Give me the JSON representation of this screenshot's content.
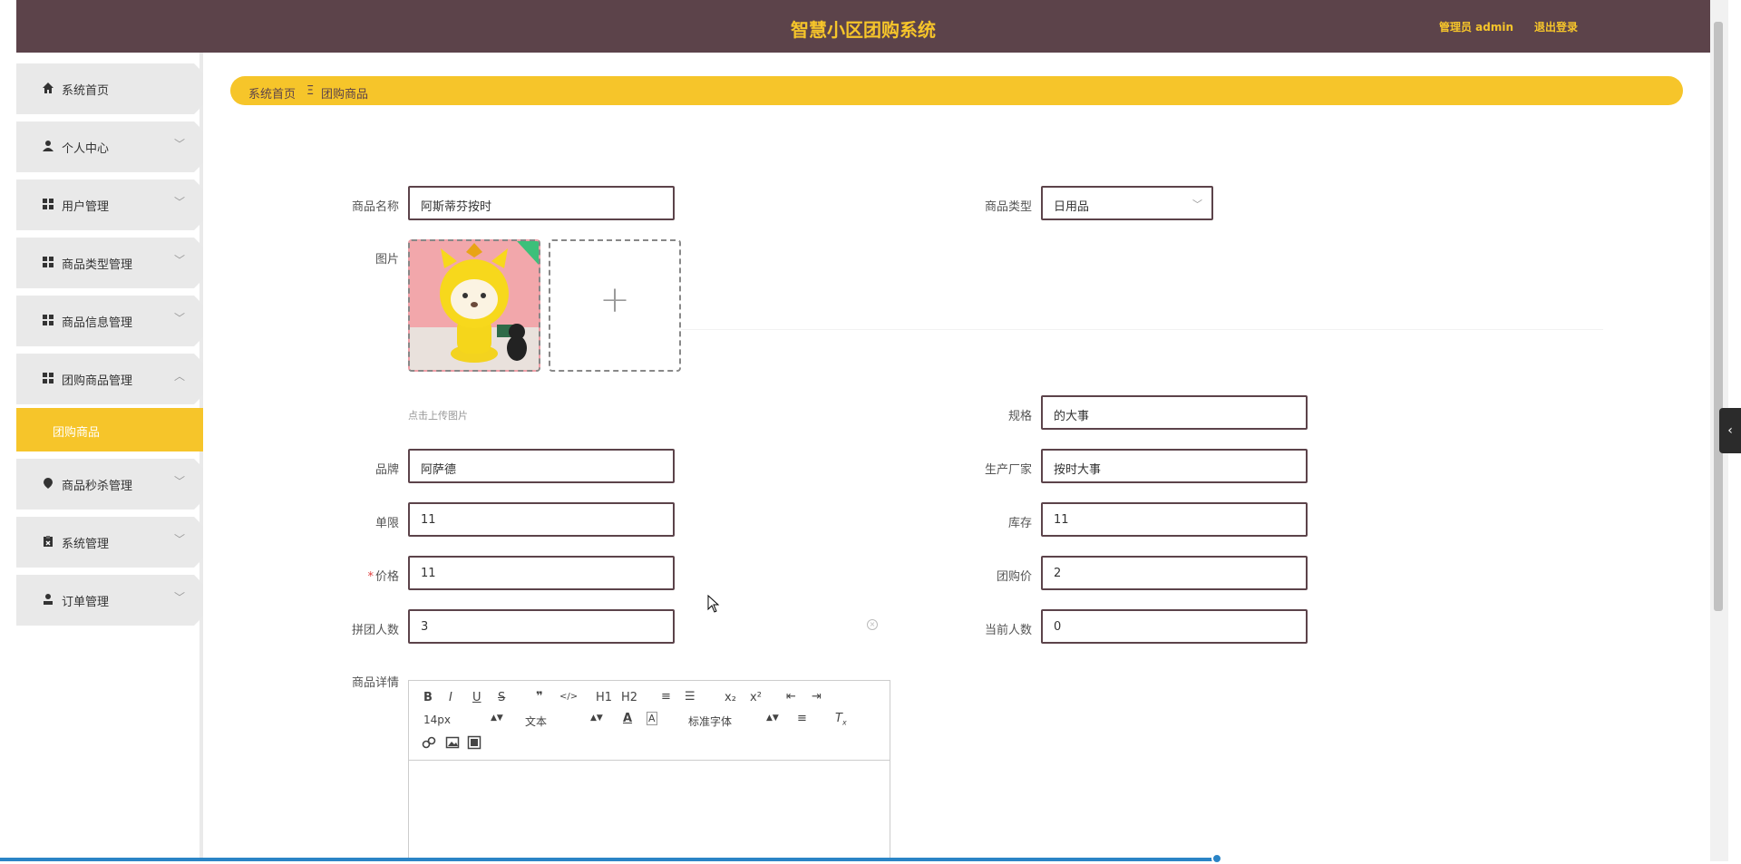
{
  "header": {
    "title": "智慧小区团购系统",
    "admin": "管理员 admin",
    "logout": "退出登录"
  },
  "sidebar": {
    "items": [
      {
        "label": "系统首页",
        "icon": "home-icon"
      },
      {
        "label": "个人中心",
        "icon": "user-icon"
      },
      {
        "label": "用户管理",
        "icon": "grid-icon"
      },
      {
        "label": "商品类型管理",
        "icon": "grid-icon"
      },
      {
        "label": "商品信息管理",
        "icon": "grid-icon"
      },
      {
        "label": "团购商品管理",
        "icon": "grid-icon"
      },
      {
        "label": "商品秒杀管理",
        "icon": "location-icon"
      },
      {
        "label": "系统管理",
        "icon": "clipboard-icon"
      },
      {
        "label": "订单管理",
        "icon": "person-icon"
      }
    ],
    "active_sub": "团购商品"
  },
  "breadcrumb": {
    "home": "系统首页",
    "sep": "Ξ",
    "current": "团购商品"
  },
  "form": {
    "name": {
      "label": "商品名称",
      "value": "阿斯蒂芬按时"
    },
    "type": {
      "label": "商品类型",
      "value": "日用品"
    },
    "image": {
      "label": "图片",
      "hint": "点击上传图片"
    },
    "spec": {
      "label": "规格",
      "value": "的大事"
    },
    "brand": {
      "label": "品牌",
      "value": "阿萨德"
    },
    "maker": {
      "label": "生产厂家",
      "value": "按时大事"
    },
    "limit": {
      "label": "单限",
      "value": "11"
    },
    "stock": {
      "label": "库存",
      "value": "11"
    },
    "price": {
      "label": "价格",
      "value": "11",
      "required_mark": "*"
    },
    "group_price": {
      "label": "团购价",
      "value": "2"
    },
    "group_size": {
      "label": "拼团人数",
      "value": "3"
    },
    "current": {
      "label": "当前人数",
      "value": "0"
    },
    "details": {
      "label": "商品详情"
    }
  },
  "editor": {
    "buttons": [
      "B",
      "I",
      "U",
      "S",
      "❞",
      "</>",
      "H1",
      "H2",
      "≡",
      "☰",
      "x₂",
      "x²",
      "⇤",
      "⇥"
    ],
    "font_size": "14px",
    "text_style": "文本",
    "font_family": "标准字体"
  },
  "colors": {
    "topbar": "#5c434a",
    "accent": "#f6c52a"
  }
}
